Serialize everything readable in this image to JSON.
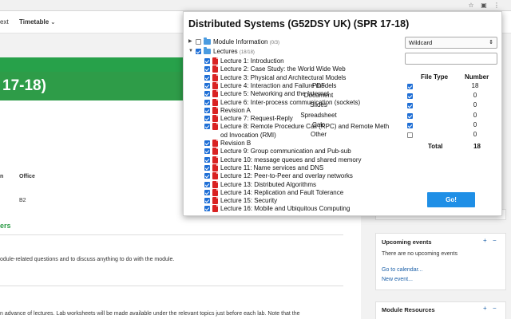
{
  "navbar": {
    "item_text": "ext",
    "item_timetable": "Timetable",
    "caret": "⌄"
  },
  "banner": {
    "title": "17-18)"
  },
  "main": {
    "col_n": "n",
    "col_office": "Office",
    "office_value": "B2",
    "green_partial": "ers",
    "text_line1": "odule-related questions and to discuss anything to do with the module.",
    "text_line2": "n advance of lectures. Lab worksheets will be made available under the relevant topics just before each lab. Note that the"
  },
  "sidebar": {
    "upcoming": {
      "title": "Upcoming events",
      "empty": "There are no upcoming events",
      "go_calendar": "Go to calendar...",
      "new_event": "New event..."
    },
    "resources": {
      "title": "Module Resources"
    },
    "icons": {
      "add": "+",
      "remove": "−"
    }
  },
  "popup": {
    "title": "Distributed Systems (G52DSY UK) (SPR 17-18)",
    "tree": {
      "module_info": {
        "label": "Module Information",
        "count": "(0/3)"
      },
      "lectures": {
        "label": "Lectures",
        "count": "(18/18)"
      },
      "items": [
        "Lecture 1: Introduction",
        "Lecture 2: Case Study: the World Wide Web",
        "Lecture 3: Physical and Architectural Models",
        "Lecture 4: Interaction and Failure models",
        "Lecture 5: Networking and the Internet",
        "Lecture 6: Inter-process communication (sockets)",
        "Revision A",
        "Lecture 7: Request-Reply",
        "Lecture 8: Remote Procedure Call (RPC) and Remote Meth",
        "od Invocation (RMI)",
        "Revision B",
        "Lecture 9: Group communication and Pub-sub",
        "Lecture 10: message queues and shared memory",
        "Lecture 11: Name services and DNS",
        "Lecture 12: Peer-to-Peer and overlay networks",
        "Lecture 13: Distributed Algorithms",
        "Lecture 14: Replication and Fault Tolerance",
        "Lecture 15: Security",
        "Lecture 16: Mobile and Ubiquitous Computing"
      ]
    },
    "filter": {
      "select_value": "Wildcard",
      "text_value": ""
    },
    "filetypes": {
      "header_type": "File Type",
      "header_number": "Number",
      "rows": [
        {
          "name": "PDF",
          "count": "18"
        },
        {
          "name": "Document",
          "count": "0"
        },
        {
          "name": "Slides",
          "count": "0"
        },
        {
          "name": "Spreadsheet",
          "count": "0"
        },
        {
          "name": "Calc",
          "count": "0"
        },
        {
          "name": "Other",
          "count": "0"
        }
      ],
      "total_label": "Total",
      "total_value": "18"
    },
    "go_label": "Go!"
  }
}
